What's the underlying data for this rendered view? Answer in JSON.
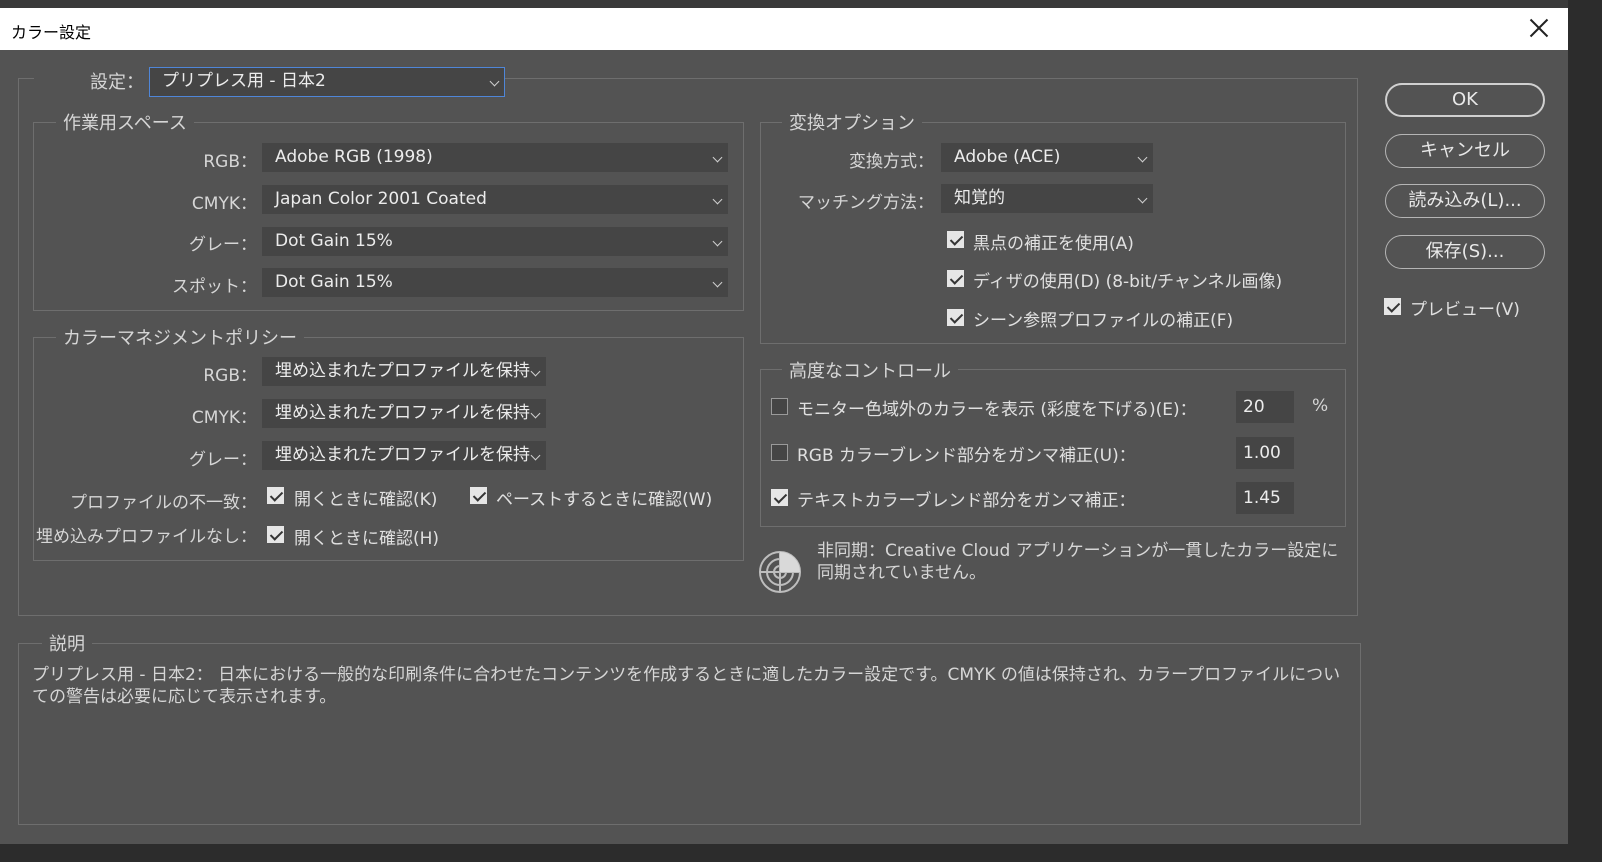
{
  "window": {
    "title": "カラー設定"
  },
  "settings": {
    "label": "設定：",
    "value": "プリプレス用 - 日本2"
  },
  "working_spaces": {
    "title": "作業用スペース",
    "rgb": {
      "label": "RGB：",
      "value": "Adobe RGB (1998)"
    },
    "cmyk": {
      "label": "CMYK：",
      "value": "Japan Color 2001 Coated"
    },
    "gray": {
      "label": "グレー：",
      "value": "Dot Gain 15%"
    },
    "spot": {
      "label": "スポット：",
      "value": "Dot Gain 15%"
    }
  },
  "policies": {
    "title": "カラーマネジメントポリシー",
    "rgb": {
      "label": "RGB：",
      "value": "埋め込まれたプロファイルを保持"
    },
    "cmyk": {
      "label": "CMYK：",
      "value": "埋め込まれたプロファイルを保持"
    },
    "gray": {
      "label": "グレー：",
      "value": "埋め込まれたプロファイルを保持"
    },
    "mismatch": {
      "label": "プロファイルの不一致：",
      "open_label": "開くときに確認(K)",
      "open_checked": true,
      "paste_label": "ペーストするときに確認(W)",
      "paste_checked": true
    },
    "missing": {
      "label": "埋め込みプロファイルなし：",
      "open_label": "開くときに確認(H)",
      "open_checked": true
    }
  },
  "conversion": {
    "title": "変換オプション",
    "engine": {
      "label": "変換方式：",
      "value": "Adobe (ACE)"
    },
    "intent": {
      "label": "マッチング方法：",
      "value": "知覚的"
    },
    "black_point": {
      "label": "黒点の補正を使用(A)",
      "checked": true
    },
    "dither": {
      "label": "ディザの使用(D) (8-bit/チャンネル画像)",
      "checked": true
    },
    "scene_referred": {
      "label": "シーン参照プロファイルの補正(F)",
      "checked": true
    }
  },
  "advanced": {
    "title": "高度なコントロール",
    "desaturate": {
      "label": "モニター色域外のカラーを表示 (彩度を下げる)(E)：",
      "checked": false,
      "value": "20",
      "unit": "%"
    },
    "blend_rgb": {
      "label": "RGB カラーブレンド部分をガンマ補正(U)：",
      "checked": false,
      "value": "1.00"
    },
    "blend_text": {
      "label": "テキストカラーブレンド部分をガンマ補正：",
      "checked": true,
      "value": "1.45"
    }
  },
  "sync": {
    "icon": "sync-status-icon",
    "text": "非同期：Creative Cloud アプリケーションが一貫したカラー設定に同期されていません。"
  },
  "description": {
    "title": "説明",
    "text": "プリプレス用 - 日本2： 日本における一般的な印刷条件に合わせたコンテンツを作成するときに適したカラー設定です。CMYK の値は保持され、カラープロファイルについての警告は必要に応じて表示されます。"
  },
  "buttons": {
    "ok": "OK",
    "cancel": "キャンセル",
    "load": "読み込み(L)...",
    "save": "保存(S)..."
  },
  "preview": {
    "label": "プレビュー(V)",
    "checked": true
  }
}
